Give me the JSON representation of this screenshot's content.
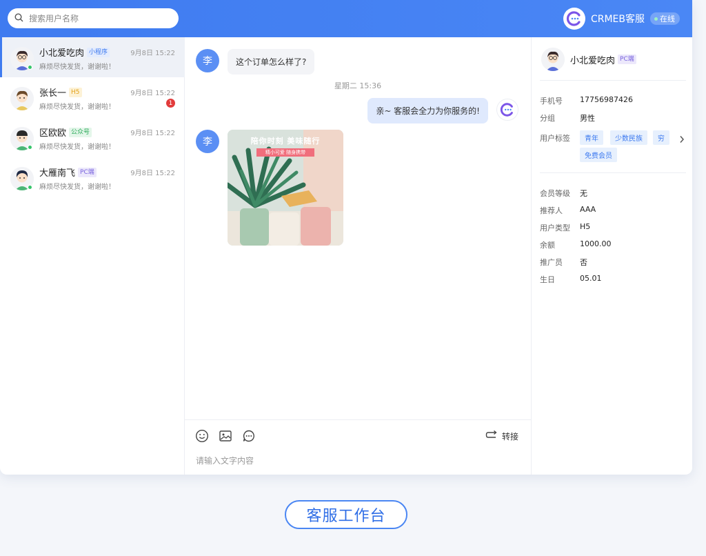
{
  "search": {
    "placeholder": "搜索用户名称"
  },
  "brand": {
    "name": "CRMEB客服",
    "status": "在线"
  },
  "conversations": [
    {
      "name": "小北爱吃肉",
      "tag": "小程序",
      "message": "麻烦尽快发货，谢谢啦！",
      "time": "9月8日 15:22",
      "unread": "",
      "online": true
    },
    {
      "name": "张长一",
      "tag": "H5",
      "message": "麻烦尽快发货，谢谢啦！",
      "time": "9月8日 15:22",
      "unread": "1",
      "online": false
    },
    {
      "name": "区欧欧",
      "tag": "公众号",
      "message": "麻烦尽快发货，谢谢啦！",
      "time": "9月8日 15:22",
      "unread": "",
      "online": true
    },
    {
      "name": "大雁南飞",
      "tag": "PC端",
      "message": "麻烦尽快发货，谢谢啦！",
      "time": "9月8日 15:22",
      "unread": "",
      "online": true
    }
  ],
  "chat": {
    "user_initial": "李",
    "message_1": "这个订单怎么样了?",
    "time_divider": "星期二 15:36",
    "reply_1": "亲~ 客服会全力为你服务的!",
    "image_banner": "陪你时刻 美味随行",
    "image_ribbon": "精小可爱 随身携带",
    "transfer_label": "转接",
    "input_placeholder": "请输入文字内容"
  },
  "profile": {
    "name": "小北爱吃肉",
    "tag": "PC端",
    "phone_label": "手机号",
    "phone": "17756987426",
    "group_label": "分组",
    "group": "男性",
    "tags_label": "用户标签",
    "tags": [
      "青年",
      "少数民族",
      "穷",
      "免费会员"
    ],
    "level_label": "会员等级",
    "level": "无",
    "referrer_label": "推荐人",
    "referrer": "AAA",
    "type_label": "用户类型",
    "type": "H5",
    "balance_label": "余额",
    "balance": "1000.00",
    "promoter_label": "推广员",
    "promoter": "否",
    "birthday_label": "生日",
    "birthday": "05.01"
  },
  "caption": "客服工作台",
  "colors": {
    "primary": "#3f7bf0",
    "online": "#36c56b",
    "badge": "#e23b3b"
  }
}
